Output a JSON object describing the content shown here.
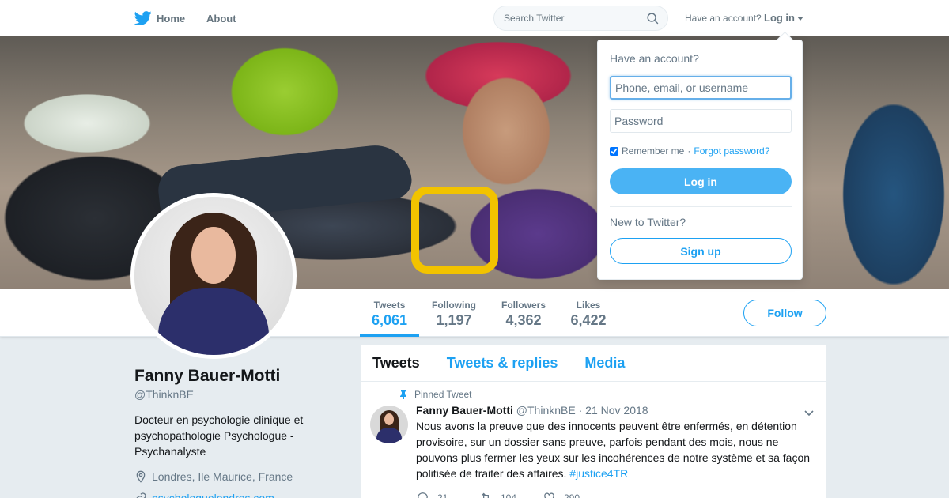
{
  "nav": {
    "home_label": "Home",
    "about_label": "About",
    "search_placeholder": "Search Twitter",
    "have_account": "Have an account?",
    "login_label": "Log in"
  },
  "brand": {
    "accent": "#1da1f2"
  },
  "stats": [
    {
      "label": "Tweets",
      "value": "6,061"
    },
    {
      "label": "Following",
      "value": "1,197"
    },
    {
      "label": "Followers",
      "value": "4,362"
    },
    {
      "label": "Likes",
      "value": "6,422"
    }
  ],
  "follow_label": "Follow",
  "profile": {
    "name": "Fanny Bauer-Motti",
    "handle": "@ThinknBE",
    "bio": "Docteur en psychologie clinique et psychopathologie Psychologue - Psychanalyste",
    "location": "Londres, Ile Maurice, France",
    "url": "psychologuelondres.com"
  },
  "timeline": {
    "tabs": [
      "Tweets",
      "Tweets & replies",
      "Media"
    ],
    "pinned_label": "Pinned Tweet",
    "tweet": {
      "name": "Fanny Bauer-Motti",
      "handle": "@ThinknBE",
      "separator": "·",
      "date": "21 Nov 2018",
      "text": "Nous avons la preuve que des innocents peuvent être enfermés, en détention provisoire, sur un dossier sans preuve, parfois pendant des mois, nous ne pouvons plus fermer les yeux sur les incohérences de notre système et sa façon politisée de traiter des affaires.",
      "hashtag": "#justice4TR",
      "replies": "21",
      "retweets": "104",
      "likes": "290"
    }
  },
  "login_dropdown": {
    "title": "Have an account?",
    "username_placeholder": "Phone, email, or username",
    "password_placeholder": "Password",
    "remember_label": "Remember me",
    "separator": "·",
    "forgot_label": "Forgot password?",
    "login_button": "Log in",
    "new_label": "New to Twitter?",
    "signup_button": "Sign up"
  }
}
